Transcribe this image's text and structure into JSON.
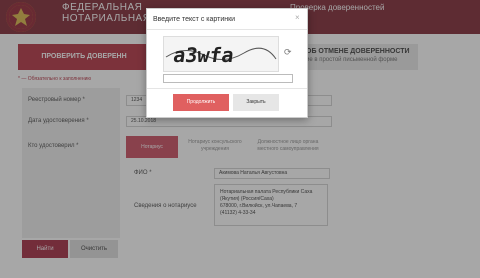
{
  "header": {
    "title_line1": "ФЕДЕРАЛЬНАЯ",
    "title_line2": "НОТАРИАЛЬНАЯ ПАЛ",
    "right_text": "Проверка доверенностей"
  },
  "tabs": {
    "active_label": "ПРОВЕРИТЬ ДОВЕРЕНН",
    "right_label": "ОБ ОТМЕНЕ ДОВЕРЕННОСТИ",
    "right_sub": "ие в простой письменной форме"
  },
  "form": {
    "required_note": "* — Обязательно к заполнению",
    "reg_number_label": "Реестровый номер *",
    "reg_number_value": "1234",
    "date_label": "Дата удостоверения *",
    "date_value": "25.10.2018",
    "certifier_label": "Кто удостоверил *",
    "segments": [
      "Нотариус",
      "Нотариус консульского учреждения",
      "Должностное лицо органа местного самоуправления"
    ],
    "fio_label": "ФИО *",
    "fio_value": "Акимова Наталья Августовна",
    "notary_info_label": "Сведения о нотариусе",
    "notary_info": [
      "Нотариальная палата Республики Саха",
      "(Якутия) (Россия/Саха)",
      "678000, г.Вилюйск, ул.Чапаева, 7",
      "(41132) 4-33-34"
    ],
    "find_button": "Найти",
    "clear_button": "Очистить"
  },
  "modal": {
    "title": "Введите текст с картинки",
    "close_symbol": "×",
    "captcha_text": "a3wfa",
    "input_value": "",
    "submit_button": "Продолжить",
    "close_button": "Закрыть"
  }
}
